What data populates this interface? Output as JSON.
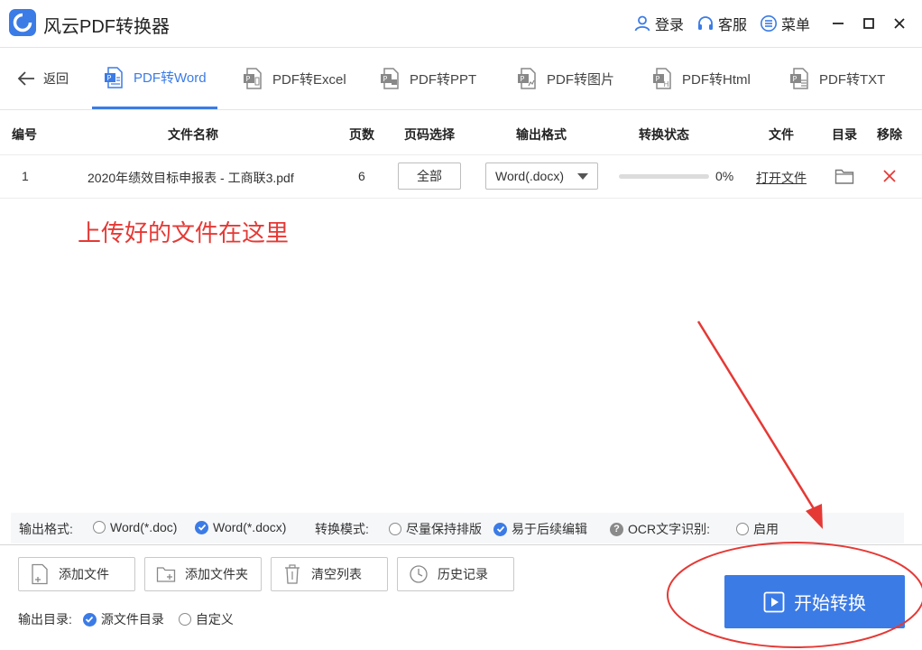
{
  "app": {
    "title": "风云PDF转换器"
  },
  "titlebar": {
    "login": "登录",
    "service": "客服",
    "menu": "菜单"
  },
  "tabs": {
    "back": "返回",
    "items": [
      {
        "label": "PDF转Word"
      },
      {
        "label": "PDF转Excel"
      },
      {
        "label": "PDF转PPT"
      },
      {
        "label": "PDF转图片"
      },
      {
        "label": "PDF转Html"
      },
      {
        "label": "PDF转TXT"
      }
    ]
  },
  "table": {
    "headers": {
      "index": "编号",
      "name": "文件名称",
      "pages": "页数",
      "range": "页码选择",
      "format": "输出格式",
      "status": "转换状态",
      "file": "文件",
      "dir": "目录",
      "remove": "移除"
    },
    "rows": [
      {
        "index": "1",
        "name": "2020年绩效目标申报表 - 工商联3.pdf",
        "pages": "6",
        "range": "全部",
        "format": "Word(.docx)",
        "progress_pct": 0,
        "progress_text": "0%",
        "open": "打开文件"
      }
    ]
  },
  "annotation": {
    "text": "上传好的文件在这里"
  },
  "options": {
    "format_label": "输出格式:",
    "format_doc": "Word(*.doc)",
    "format_docx": "Word(*.docx)",
    "mode_label": "转换模式:",
    "mode_layout": "尽量保持排版",
    "mode_edit": "易于后续编辑",
    "ocr_label": "OCR文字识别:",
    "ocr_enable": "启用"
  },
  "bottom": {
    "add_file": "添加文件",
    "add_folder": "添加文件夹",
    "clear": "清空列表",
    "history": "历史记录",
    "outdir_label": "输出目录:",
    "outdir_source": "源文件目录",
    "outdir_custom": "自定义",
    "start": "开始转换"
  },
  "colors": {
    "accent": "#3b7be6",
    "annotation": "#e53935"
  }
}
